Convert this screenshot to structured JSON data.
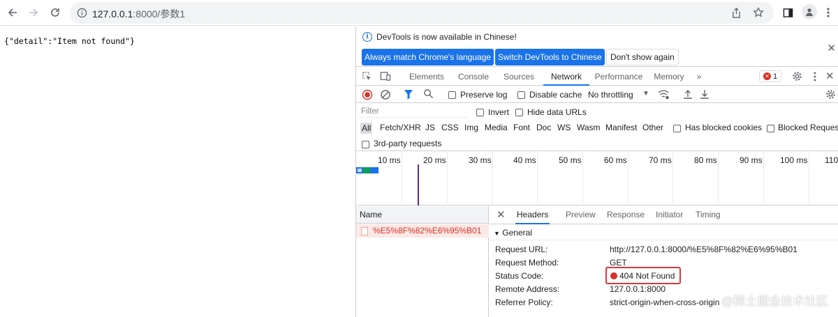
{
  "browser": {
    "url_host": "127.0.0.1",
    "url_rest": ":8000/参数1"
  },
  "page": {
    "body_text": "{\"detail\":\"Item not found\"}"
  },
  "devtools": {
    "infobar": {
      "message": "DevTools is now available in Chinese!",
      "btn_match": "Always match Chrome's language",
      "btn_switch": "Switch DevTools to Chinese",
      "btn_dont": "Don't show again"
    },
    "tabs": [
      "Elements",
      "Console",
      "Sources",
      "Network",
      "Performance",
      "Memory"
    ],
    "active_tab": "Network",
    "error_count": "1",
    "toolbar": {
      "preserve_log": "Preserve log",
      "disable_cache": "Disable cache",
      "throttling": "No throttling"
    },
    "filter": {
      "placeholder": "Filter",
      "invert": "Invert",
      "hide_data_urls": "Hide data URLs"
    },
    "types": [
      "All",
      "Fetch/XHR",
      "JS",
      "CSS",
      "Img",
      "Media",
      "Font",
      "Doc",
      "WS",
      "Wasm",
      "Manifest",
      "Other"
    ],
    "has_blocked_cookies": "Has blocked cookies",
    "blocked_requests": "Blocked Requests",
    "third_party": "3rd-party requests",
    "timeline_ticks": [
      "10 ms",
      "20 ms",
      "30 ms",
      "40 ms",
      "50 ms",
      "60 ms",
      "70 ms",
      "80 ms",
      "90 ms",
      "100 ms",
      "110"
    ],
    "name_header": "Name",
    "request_name": "%E5%8F%82%E6%95%B01",
    "detail_tabs": [
      "Headers",
      "Preview",
      "Response",
      "Initiator",
      "Timing"
    ],
    "general_label": "General",
    "headers": [
      {
        "key": "Request URL:",
        "value": "http://127.0.0.1:8000/%E5%8F%82%E6%95%B01"
      },
      {
        "key": "Request Method:",
        "value": "GET"
      },
      {
        "key": "Status Code:",
        "value": "404 Not Found"
      },
      {
        "key": "Remote Address:",
        "value": "127.0.0.1:8000"
      },
      {
        "key": "Referrer Policy:",
        "value": "strict-origin-when-cross-origin"
      }
    ]
  },
  "watermark": "@稀土掘金技术社区",
  "colors": {
    "accent": "#1a73e8",
    "error": "#d93025",
    "highlight_box": "#e0343b"
  }
}
